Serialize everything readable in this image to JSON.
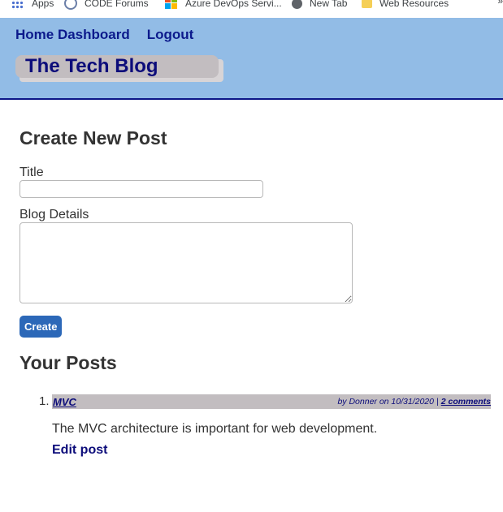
{
  "bookmarks": [
    {
      "label": "Apps",
      "icon": "apps-grid-icon"
    },
    {
      "label": "CODE Forums",
      "icon": "forum-icon"
    },
    {
      "label": "Azure DevOps Servi...",
      "icon": "azure-devops-icon"
    },
    {
      "label": "New Tab",
      "icon": "globe-icon"
    },
    {
      "label": "Web Resources",
      "icon": "folder-icon"
    }
  ],
  "bookmarks_overflow": "»",
  "nav": {
    "home_label": "Home Dashboard",
    "logout_label": "Logout"
  },
  "site": {
    "title": "The Tech Blog"
  },
  "create_form": {
    "heading": "Create New Post",
    "title_label": "Title",
    "title_value": "",
    "details_label": "Blog Details",
    "details_value": "",
    "submit_label": "Create"
  },
  "posts_section": {
    "heading": "Your Posts",
    "posts": [
      {
        "number": "1.",
        "title": "MVC",
        "meta": "by Donner on 10/31/2020",
        "separator": "|",
        "comments": "2 comments",
        "body": "The MVC architecture is important for web development.",
        "edit_label": "Edit post"
      }
    ]
  },
  "colors": {
    "header_bg": "#92bce6",
    "header_border": "#0c1587",
    "nav_link": "#0c1a8c",
    "brand_bg": "#c2bdc0",
    "button_bg": "#2c68b8"
  }
}
